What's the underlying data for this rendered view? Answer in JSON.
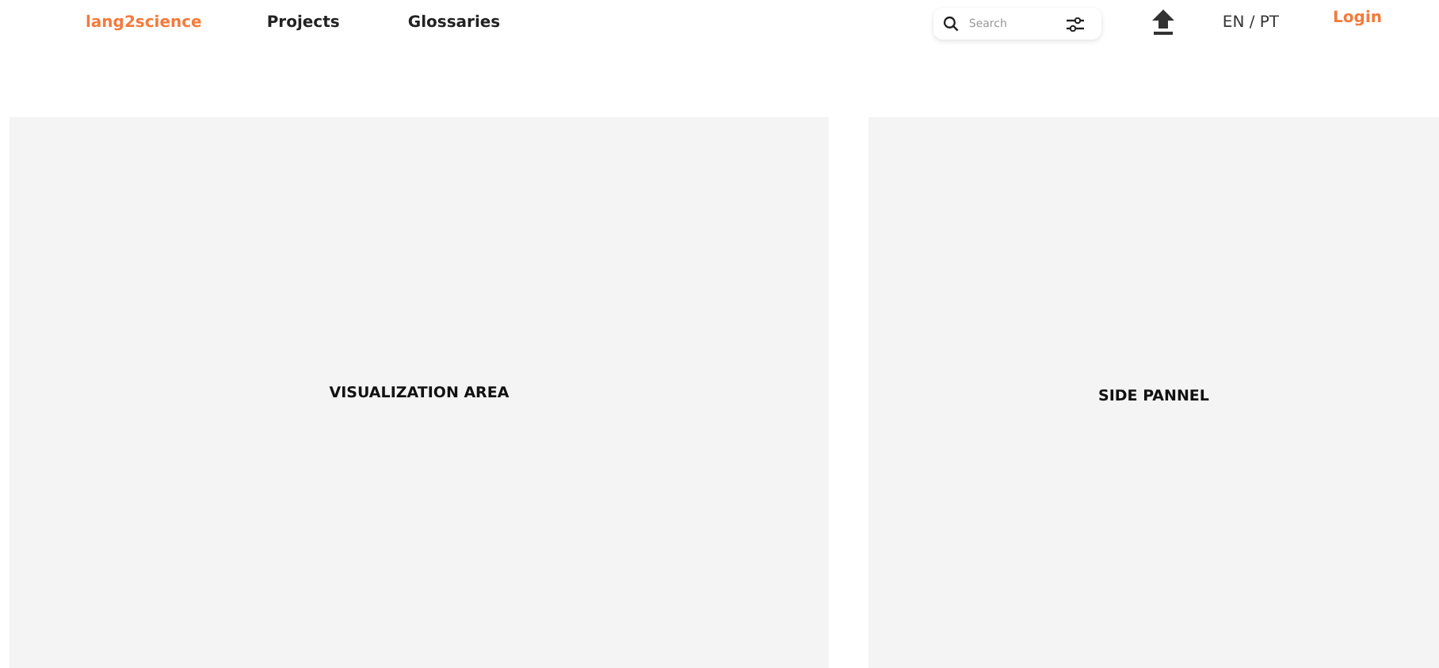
{
  "nav": {
    "logo": "lang2science",
    "links": [
      "Projects",
      "Glossaries"
    ],
    "search": {
      "placeholder": "Search"
    },
    "language": "EN / PT",
    "login": "Login"
  },
  "panels": {
    "visualization": "VISUALIZATION AREA",
    "side": "SIDE PANNEL"
  }
}
